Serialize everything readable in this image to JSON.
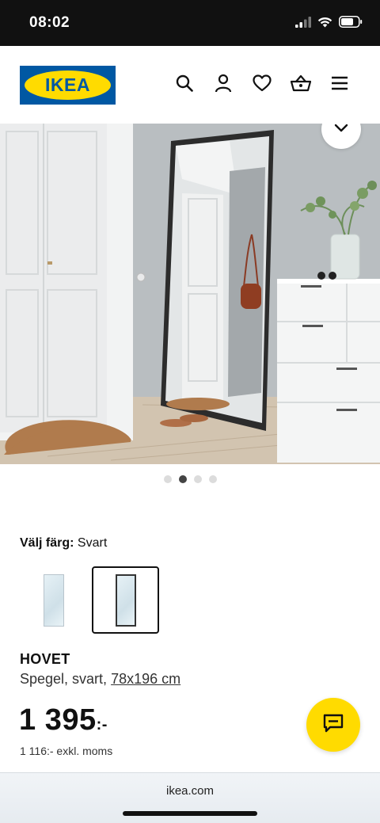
{
  "status_bar": {
    "time": "08:02",
    "icons": [
      "cellular-signal-icon",
      "wifi-icon",
      "battery-icon"
    ]
  },
  "header": {
    "logo_text": "IKEA",
    "icons": [
      "search-icon",
      "user-icon",
      "heart-icon",
      "basket-icon",
      "menu-icon"
    ]
  },
  "hero": {
    "image": "mirror-hallway-photo",
    "collapse_icon": "chevron-down-icon",
    "carousel_count": 4,
    "carousel_active_index": 1
  },
  "color_picker": {
    "label": "Välj färg:",
    "selected_value": "Svart",
    "options": [
      "white-mirror-swatch",
      "black-mirror-swatch"
    ],
    "selected_index": 1
  },
  "product": {
    "name": "HOVET",
    "description": "Spegel, svart,",
    "size_link": "78x196 cm",
    "price": "1 395",
    "price_suffix": ":-",
    "price_exvat": "1 116:- exkl. moms"
  },
  "chat": {
    "icon": "chat-icon"
  },
  "browser": {
    "url": "ikea.com"
  },
  "colors": {
    "ikea_blue": "#0058a3",
    "ikea_yellow": "#ffdb00",
    "status_bar": "#111111"
  }
}
